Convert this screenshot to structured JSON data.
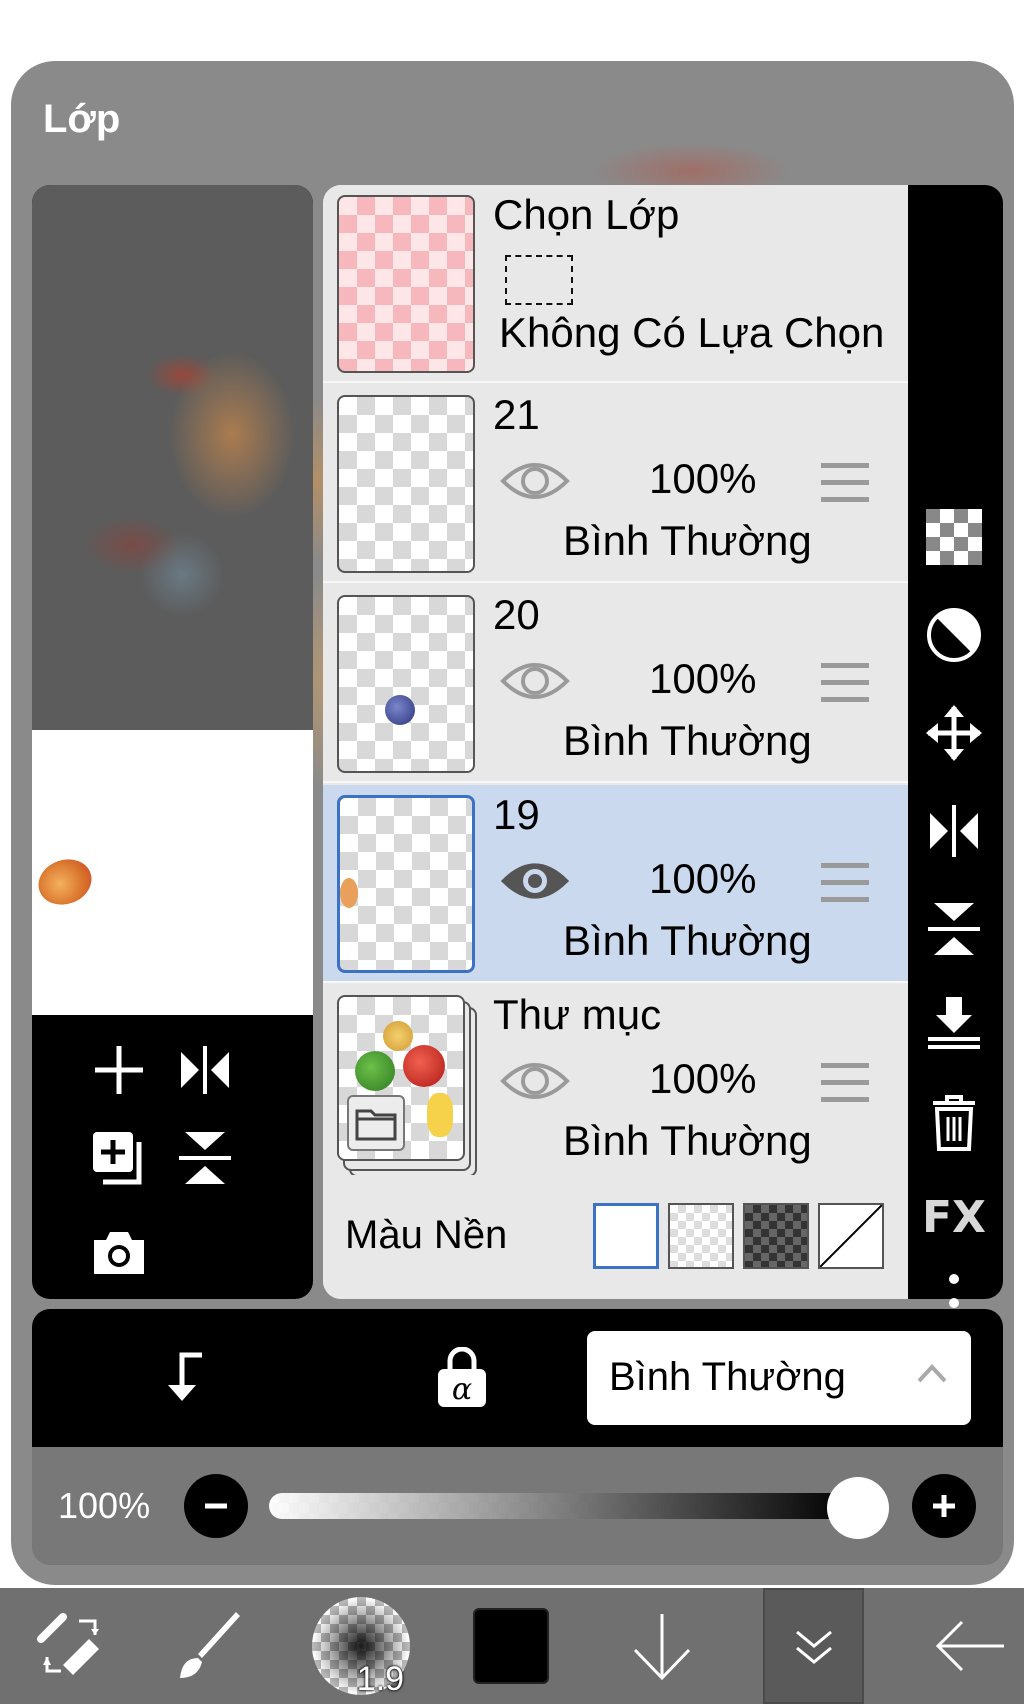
{
  "dialog": {
    "title": "Lớp"
  },
  "layers": {
    "selection_layer": {
      "name": "Chọn Lớp",
      "status": "Không Có Lựa Chọn"
    },
    "items": [
      {
        "name": "21",
        "opacity": "100%",
        "blend": "Bình Thường",
        "visible_icon": "eye-outline-icon"
      },
      {
        "name": "20",
        "opacity": "100%",
        "blend": "Bình Thường",
        "visible_icon": "eye-outline-icon"
      },
      {
        "name": "19",
        "opacity": "100%",
        "blend": "Bình Thường",
        "visible_icon": "eye-filled-icon",
        "selected": true
      },
      {
        "name": "Thư mục",
        "opacity": "100%",
        "blend": "Bình Thường",
        "visible_icon": "eye-outline-icon",
        "is_folder": true
      }
    ],
    "background": {
      "label": "Màu Nền",
      "options": [
        "white",
        "checker-light",
        "checker-dark",
        "none"
      ],
      "selected": "white"
    }
  },
  "right_toolbar": {
    "fx_label": "FX",
    "icons": [
      "transparency-checker-icon",
      "clipping-half-circle-icon",
      "move-icon",
      "flip-horizontal-icon",
      "flip-vertical-icon",
      "merge-down-icon",
      "trash-icon",
      "fx-icon",
      "more-vertical-icon"
    ]
  },
  "preview_tools": [
    "add-layer-icon",
    "flip-horizontal-icon",
    "duplicate-layer-icon",
    "flip-vertical-icon",
    "camera-icon"
  ],
  "blend_bar": {
    "blend_mode": "Bình Thường",
    "icons": [
      "clip-arrow-icon",
      "alpha-lock-icon",
      "chevron-up-icon"
    ]
  },
  "opacity_bar": {
    "label": "100%",
    "value": 1.0
  },
  "appbar": {
    "brush_size": "1.9",
    "color": "#000000",
    "icons": [
      "tool-switch-icon",
      "brush-icon",
      "brush-size-preview",
      "color-swatch",
      "arrow-down-icon",
      "layer-tab-icon",
      "back-arrow-icon"
    ]
  },
  "colors": {
    "selected_row": "#cbd9ee",
    "accent": "#3b72c4",
    "panel": "#e8e8e8",
    "dialog": "#8a8a8a"
  }
}
